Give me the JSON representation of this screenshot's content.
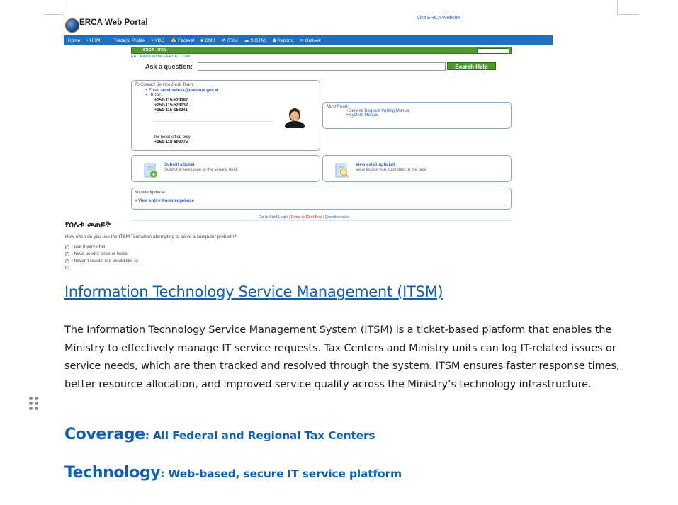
{
  "portal": {
    "logo_text": "ERCA Web Portal",
    "visit_link": "Visit ERCA Website",
    "nav": [
      {
        "icon": "home-icon",
        "glyph": "",
        "label": "Home"
      },
      {
        "icon": "bullet-icon",
        "glyph": "•",
        "label": "HRM"
      },
      {
        "icon": "user-icon",
        "glyph": "👤",
        "label": "Traders' Profile"
      },
      {
        "icon": "caret-icon",
        "glyph": "▾",
        "label": "VDD"
      },
      {
        "icon": "home-icon",
        "glyph": "🏠",
        "label": "Facevet"
      },
      {
        "icon": "folder-icon",
        "glyph": "■",
        "label": "DMS"
      },
      {
        "icon": "exchange-icon",
        "glyph": "⇄",
        "label": "ITSM"
      },
      {
        "icon": "cloud-icon",
        "glyph": "☁",
        "label": "SIGTAS"
      },
      {
        "icon": "chart-icon",
        "glyph": "▮",
        "label": "Reports"
      },
      {
        "icon": "mail-icon",
        "glyph": "✉",
        "label": "Outlook"
      }
    ],
    "bar_title": "ERCA - ITSM",
    "breadcrumb": "ERCA Web Portal > ERCA - ITSM",
    "ask_label": "Ask a question:",
    "ask_value": "",
    "search_button": "Search Help",
    "contact": {
      "title": "To Contact Service Desk Team:",
      "email_prefix": "Email ",
      "email": "servicedesk@revenue.gov.et",
      "tel_label": "Or Tel:-",
      "numbers": [
        "+251-115-529087",
        "+251-115-529132",
        "+251-115-156241"
      ],
      "head_office_label": "for head office only",
      "head_office_number": "+251-118-693775"
    },
    "must_read": {
      "title": "Must Read:",
      "links": [
        "Service Request Writing Manual",
        "System Manual"
      ]
    },
    "submit_ticket": {
      "title": "Submit a ticket",
      "subtitle": "Submit a new issue to the service desk"
    },
    "view_ticket": {
      "title": "View existing ticket",
      "subtitle": "View tickets you submitted in the past"
    },
    "knowledgebase": {
      "title": "Knowledgebase",
      "link": "» View entire Knowledgebase"
    },
    "footer": {
      "staff_login": "Go to Staff Login",
      "sep1": " | ",
      "chat": "Enter to Chat Box",
      "sep2": " | ",
      "questionnaire": "Questionnaire"
    },
    "survey": {
      "title": "የሰሌቱ መጠይቅ",
      "question": "How often do you use the ITSM Tool when attempting to solve a computer problem?",
      "options": [
        "I use it very often",
        "I have used it once or twice",
        "I haven't used if but would like to"
      ]
    }
  },
  "document": {
    "title": "Information Technology Service Management (ITSM)",
    "body": "The Information Technology Service Management System (ITSM) is a ticket-based platform that enables the Ministry to effectively manage IT service requests. Tax Centers and Ministry units can log IT-related issues or service needs, which are then tracked and resolved through the system. ITSM ensures faster response times, better resource allocation, and improved service quality across the Ministry’s technology infrastructure.",
    "coverage_label": "Coverage",
    "coverage_value": ": All Federal and Regional Tax Centers",
    "technology_label": "Technology",
    "technology_value": ": Web-based, secure IT service platform"
  },
  "colors": {
    "heading_blue": "#1060b0",
    "nav_blue": "#1f6fbf",
    "portal_green": "#4f9a2f"
  }
}
